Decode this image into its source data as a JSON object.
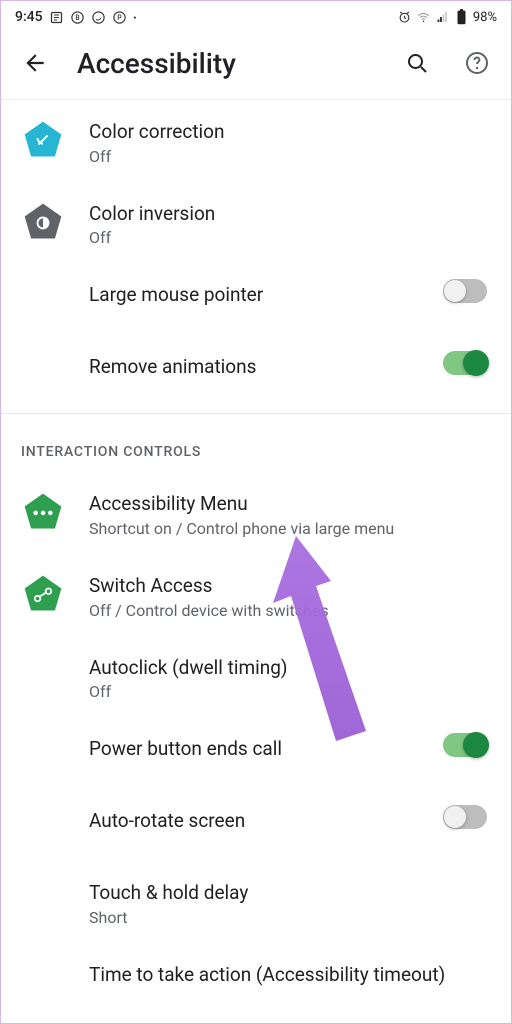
{
  "status": {
    "time": "9:45",
    "battery": "98%"
  },
  "header": {
    "title": "Accessibility"
  },
  "section1": {
    "items": [
      {
        "title": "Color correction",
        "sub": "Off"
      },
      {
        "title": "Color inversion",
        "sub": "Off"
      },
      {
        "title": "Large mouse pointer"
      },
      {
        "title": "Remove animations"
      }
    ]
  },
  "section2": {
    "header": "INTERACTION CONTROLS",
    "items": [
      {
        "title": "Accessibility Menu",
        "sub": "Shortcut on / Control phone via large menu"
      },
      {
        "title": "Switch Access",
        "sub": "Off / Control device with switches"
      },
      {
        "title": "Autoclick (dwell timing)",
        "sub": "Off"
      },
      {
        "title": "Power button ends call"
      },
      {
        "title": "Auto-rotate screen"
      },
      {
        "title": "Touch & hold delay",
        "sub": "Short"
      },
      {
        "title": "Time to take action (Accessibility timeout)"
      }
    ]
  }
}
